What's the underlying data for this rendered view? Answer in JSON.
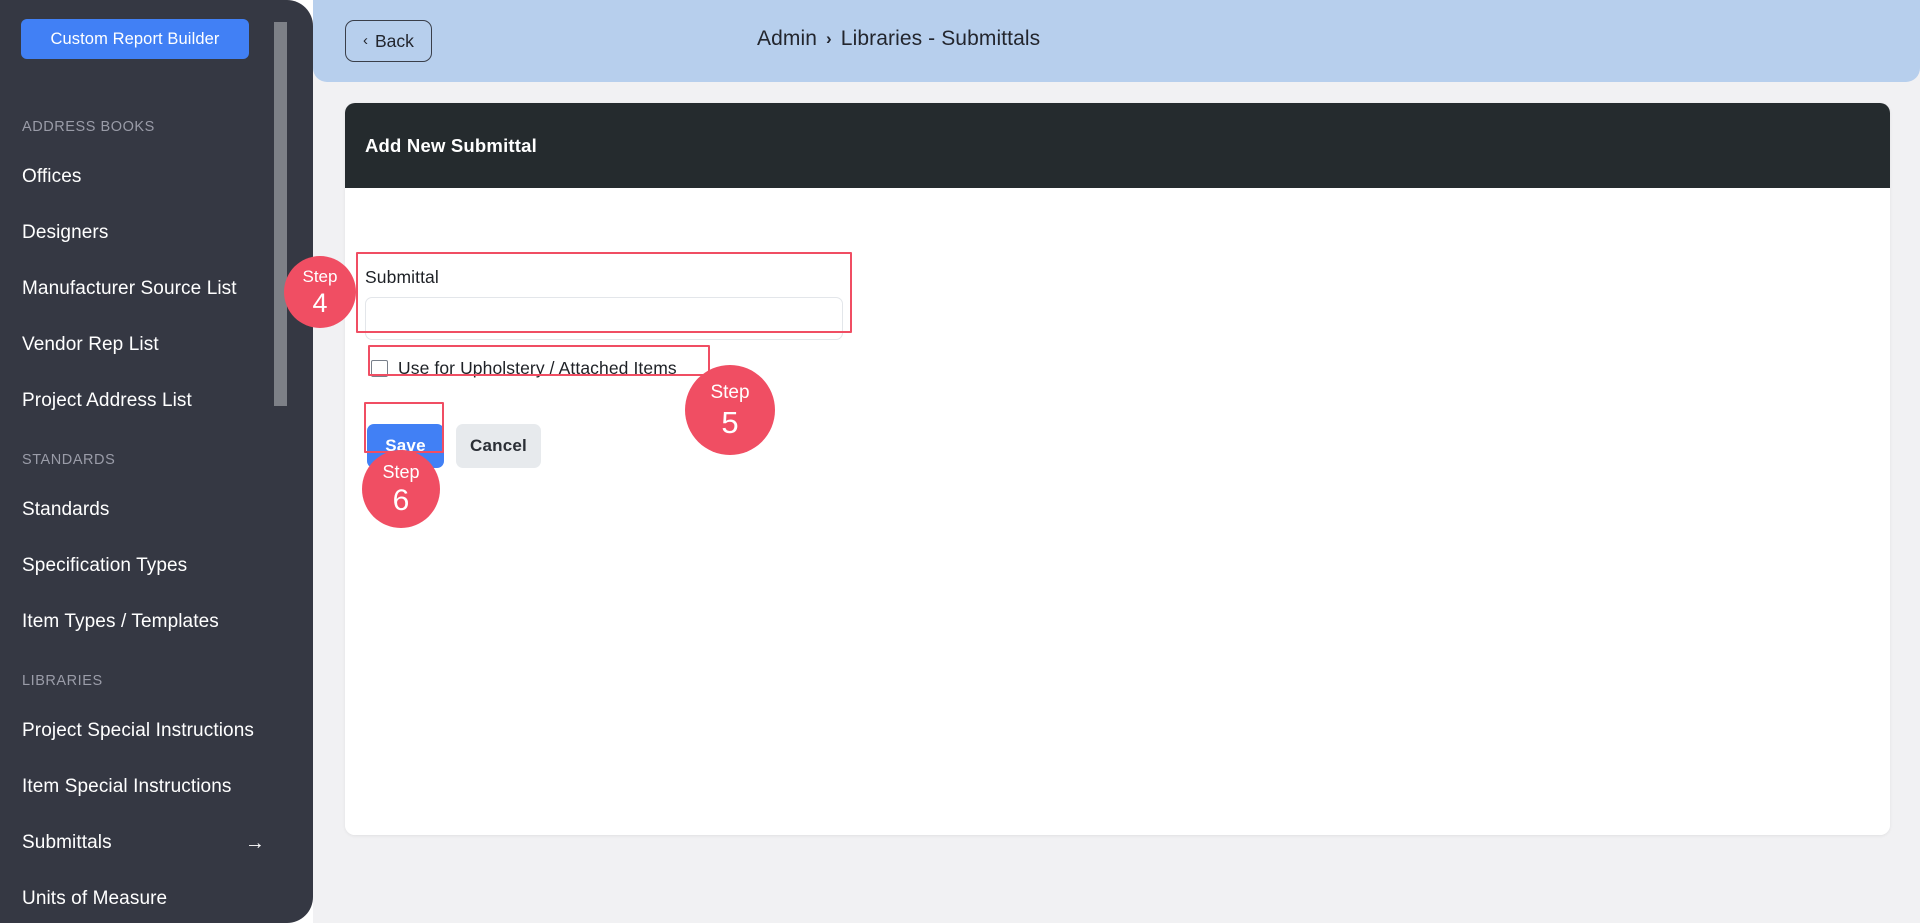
{
  "sidebar": {
    "custom_report_builder_label": "Custom Report Builder",
    "sections": [
      {
        "label": "ADDRESS BOOKS",
        "items": [
          {
            "label": "Offices",
            "arrow": ""
          },
          {
            "label": "Designers",
            "arrow": ""
          },
          {
            "label": "Manufacturer Source List",
            "arrow": ""
          },
          {
            "label": "Vendor Rep List",
            "arrow": ""
          },
          {
            "label": "Project Address List",
            "arrow": ""
          }
        ]
      },
      {
        "label": "STANDARDS",
        "items": [
          {
            "label": "Standards",
            "arrow": ""
          },
          {
            "label": "Specification Types",
            "arrow": ""
          },
          {
            "label": "Item Types / Templates",
            "arrow": ""
          }
        ]
      },
      {
        "label": "LIBRARIES",
        "items": [
          {
            "label": "Project Special Instructions",
            "arrow": ""
          },
          {
            "label": "Item Special Instructions",
            "arrow": ""
          },
          {
            "label": "Submittals",
            "arrow": "→"
          },
          {
            "label": "Units of Measure",
            "arrow": ""
          }
        ]
      }
    ]
  },
  "topbar": {
    "back_label": "Back",
    "back_chevron": "‹",
    "breadcrumb": {
      "root": "Admin",
      "separator": "›",
      "current": "Libraries - Submittals"
    },
    "close_icon": "close-circle-icon"
  },
  "card": {
    "header_title": "Add New Submittal",
    "form": {
      "submittal_label": "Submittal",
      "submittal_value": "",
      "submittal_placeholder": "",
      "checkbox_label": "Use for Upholstery / Attached Items",
      "checkbox_checked": false,
      "save_label": "Save",
      "cancel_label": "Cancel"
    }
  },
  "steps": [
    {
      "word": "Step",
      "number": "4"
    },
    {
      "word": "Step",
      "number": "5"
    },
    {
      "word": "Step",
      "number": "6"
    }
  ],
  "colors": {
    "accent_blue": "#4180f5",
    "highlight_red": "#f04e63",
    "sidebar_bg": "#353843",
    "topbar_bg": "#b7cfed",
    "card_header_bg": "#252b2e"
  }
}
